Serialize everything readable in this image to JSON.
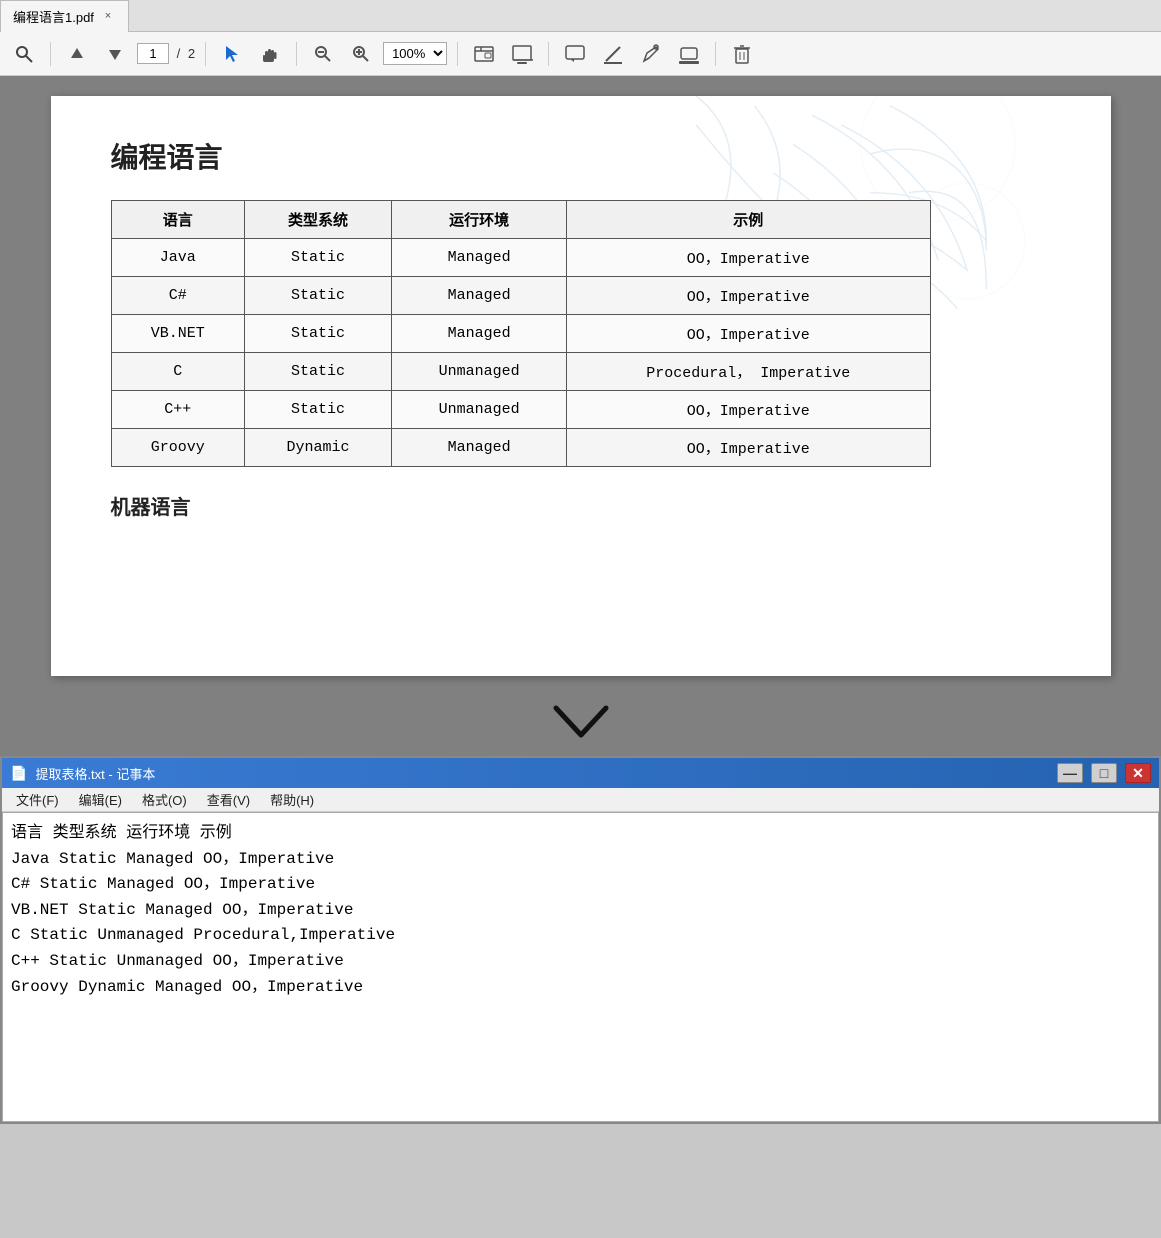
{
  "tab": {
    "filename": "编程语言1.pdf",
    "close_label": "×"
  },
  "toolbar": {
    "search_icon": "🔍",
    "up_icon": "↑",
    "down_icon": "↓",
    "page_current": "1",
    "page_separator": "/",
    "page_total": "2",
    "select_icon": "▲",
    "hand_icon": "✋",
    "zoom_out_icon": "−",
    "zoom_in_icon": "+",
    "zoom_value": "100%",
    "zoom_dropdown": "▼",
    "snapshot_icon": "⊞",
    "text_icon": "⌨",
    "comment_icon": "💬",
    "highlight_icon": "✏",
    "draw_icon": "✒",
    "stamp_icon": "📋",
    "delete_icon": "🗑"
  },
  "pdf": {
    "title": "编程语言",
    "table": {
      "headers": [
        "语言",
        "类型系统",
        "运行环境",
        "示例"
      ],
      "rows": [
        [
          "Java",
          "Static",
          "Managed",
          "OO，Imperative"
        ],
        [
          "C#",
          "Static",
          "Managed",
          "OO，Imperative"
        ],
        [
          "VB.NET",
          "Static",
          "Managed",
          "OO，Imperative"
        ],
        [
          "C",
          "Static",
          "Unmanaged",
          "Procedural，\nImperative"
        ],
        [
          "C++",
          "Static",
          "Unmanaged",
          "OO，Imperative"
        ],
        [
          "Groovy",
          "Dynamic",
          "Managed",
          "OO，Imperative"
        ]
      ]
    },
    "subtitle": "机器语言"
  },
  "notepad": {
    "title": "提取表格.txt - 记事本",
    "icon": "📄",
    "buttons": {
      "minimize": "—",
      "maximize": "□",
      "close": "✕"
    },
    "menu": [
      "文件(F)",
      "编辑(E)",
      "格式(O)",
      "查看(V)",
      "帮助(H)"
    ],
    "content": "语言 类型系统 运行环境 示例\nJava Static Managed OO，Imperative\nC# Static Managed OO，Imperative\nVB.NET Static Managed OO，Imperative\nC Static Unmanaged Procedural,Imperative\nC++ Static Unmanaged OO，Imperative\nGroovy Dynamic Managed OO，Imperative\n"
  }
}
